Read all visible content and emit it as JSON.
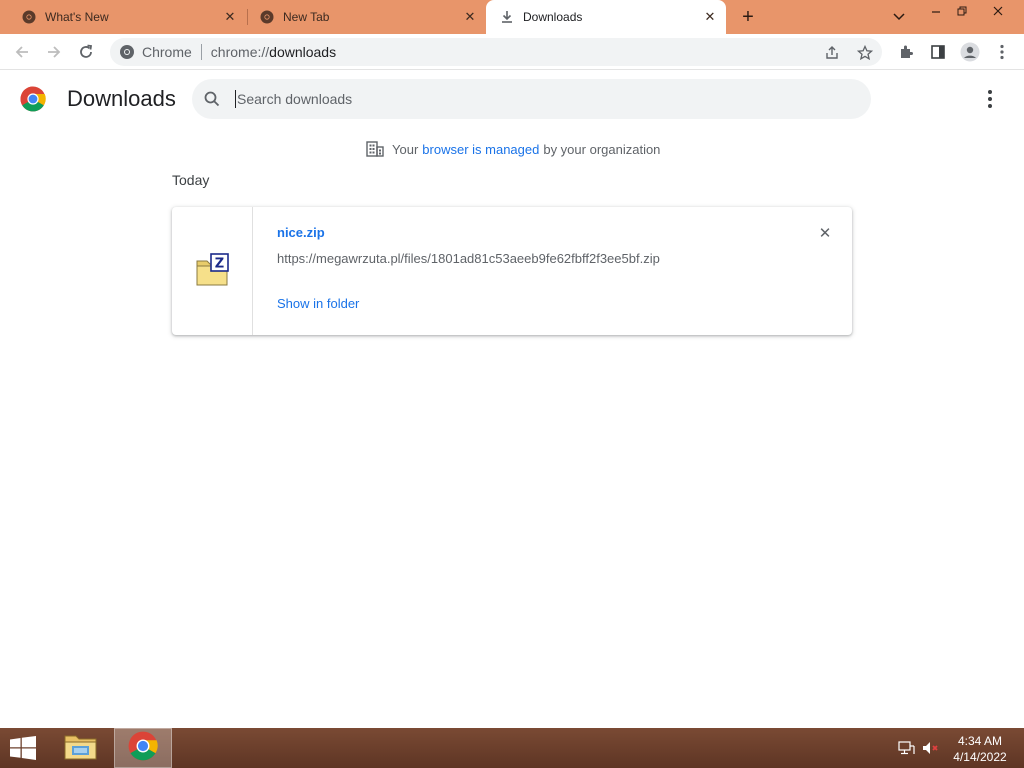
{
  "tabs": [
    {
      "title": "What's New",
      "active": false,
      "icon": "chrome-icon"
    },
    {
      "title": "New Tab",
      "active": false,
      "icon": "chrome-icon"
    },
    {
      "title": "Downloads",
      "active": true,
      "icon": "download-icon"
    }
  ],
  "omnibox": {
    "site_label": "Chrome",
    "url_scheme": "chrome://",
    "url_host": "downloads"
  },
  "page": {
    "title": "Downloads",
    "search_placeholder": "Search downloads"
  },
  "managed_notice": {
    "prefix": "Your",
    "link": "browser is managed",
    "suffix": "by your organization"
  },
  "downloads": {
    "date_group": "Today",
    "items": [
      {
        "file_name": "nice.zip",
        "url": "https://megawrzuta.pl/files/1801ad81c53aeeb9fe62fbff2f3ee5bf.zip",
        "action": "Show in folder",
        "icon": "zip-file-icon"
      }
    ]
  },
  "taskbar": {
    "time": "4:34 AM",
    "date": "4/14/2022"
  },
  "colors": {
    "titlebar": "#e8956a",
    "accent_link": "#1a73e8",
    "taskbar": "#6b3f2c"
  }
}
